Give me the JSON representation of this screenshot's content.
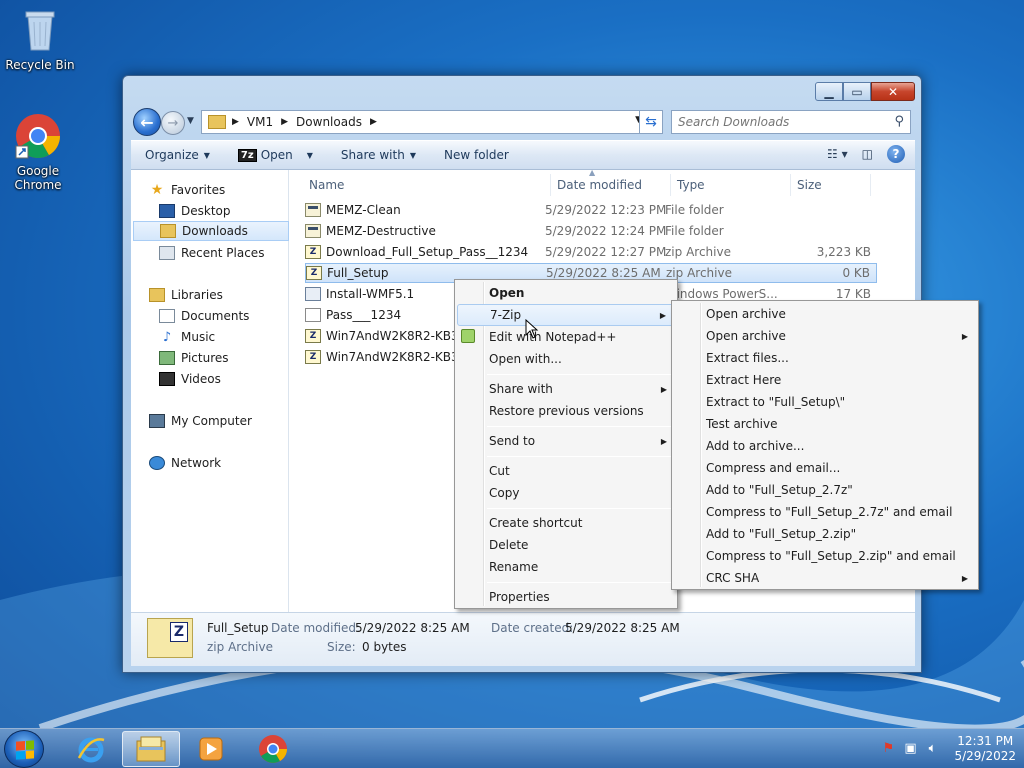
{
  "desktop": {
    "icons": [
      {
        "label": "Recycle Bin"
      },
      {
        "label": "Google Chrome"
      }
    ]
  },
  "window": {
    "address": {
      "crumbs": [
        "VM1",
        "Downloads"
      ]
    },
    "search": {
      "placeholder": "Search Downloads"
    },
    "toolbar": {
      "organize": "Organize",
      "open": "Open",
      "share_with": "Share with",
      "new_folder": "New folder"
    },
    "nav": {
      "favorites": "Favorites",
      "desktop": "Desktop",
      "downloads": "Downloads",
      "recent_places": "Recent Places",
      "libraries": "Libraries",
      "documents": "Documents",
      "music": "Music",
      "pictures": "Pictures",
      "videos": "Videos",
      "my_computer": "My Computer",
      "network": "Network"
    },
    "columns": {
      "name": "Name",
      "date": "Date modified",
      "type": "Type",
      "size": "Size"
    },
    "files": [
      {
        "name": "MEMZ-Clean",
        "date": "5/29/2022 12:23 PM",
        "type": "File folder",
        "size": "",
        "icon": "folder"
      },
      {
        "name": "MEMZ-Destructive",
        "date": "5/29/2022 12:24 PM",
        "type": "File folder",
        "size": "",
        "icon": "folder"
      },
      {
        "name": "Download_Full_Setup_Pass__1234",
        "date": "5/29/2022 12:27 PM",
        "type": "zip Archive",
        "size": "3,223 KB",
        "icon": "zip"
      },
      {
        "name": "Full_Setup",
        "date": "5/29/2022 8:25 AM",
        "type": "zip Archive",
        "size": "0 KB",
        "icon": "zip"
      },
      {
        "name": "Install-WMF5.1",
        "date": "",
        "type": "Windows PowerS...",
        "size": "17 KB",
        "icon": "ps"
      },
      {
        "name": "Pass___1234",
        "date": "",
        "type": "",
        "size": "",
        "icon": "txt"
      },
      {
        "name": "Win7AndW2K8R2-KB319",
        "date": "",
        "type": "",
        "size": "",
        "icon": "zip"
      },
      {
        "name": "Win7AndW2K8R2-KB319",
        "date": "",
        "type": "",
        "size": "",
        "icon": "zip"
      }
    ],
    "details": {
      "name": "Full_Setup",
      "type": "zip Archive",
      "modified_label": "Date modified:",
      "modified": "5/29/2022 8:25 AM",
      "created_label": "Date created:",
      "created": "5/29/2022 8:25 AM",
      "size_label": "Size:",
      "size": "0 bytes"
    }
  },
  "context_menu": {
    "items": [
      "Open",
      "7-Zip",
      "Edit with Notepad++",
      "Open with...",
      "Share with",
      "Restore previous versions",
      "Send to",
      "Cut",
      "Copy",
      "Create shortcut",
      "Delete",
      "Rename",
      "Properties"
    ]
  },
  "zip_submenu": {
    "items": [
      "Open archive",
      "Open archive",
      "Extract files...",
      "Extract Here",
      "Extract to \"Full_Setup\\\"",
      "Test archive",
      "Add to archive...",
      "Compress and email...",
      "Add to \"Full_Setup_2.7z\"",
      "Compress to \"Full_Setup_2.7z\" and email",
      "Add to \"Full_Setup_2.zip\"",
      "Compress to \"Full_Setup_2.zip\" and email",
      "CRC SHA"
    ]
  },
  "taskbar": {
    "time": "12:31 PM",
    "date": "5/29/2022"
  }
}
